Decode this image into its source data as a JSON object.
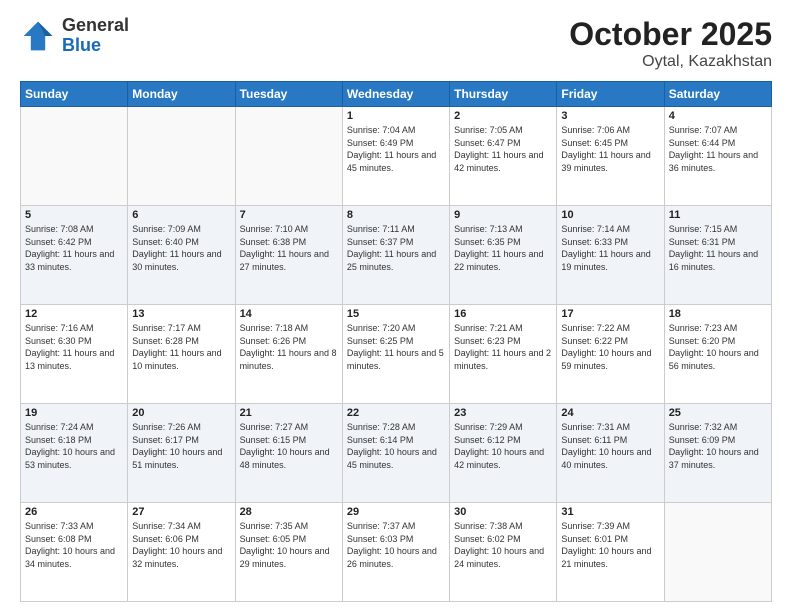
{
  "logo": {
    "general": "General",
    "blue": "Blue"
  },
  "title": "October 2025",
  "subtitle": "Oytal, Kazakhstan",
  "weekdays": [
    "Sunday",
    "Monday",
    "Tuesday",
    "Wednesday",
    "Thursday",
    "Friday",
    "Saturday"
  ],
  "weeks": [
    [
      {
        "day": "",
        "sunrise": "",
        "sunset": "",
        "daylight": ""
      },
      {
        "day": "",
        "sunrise": "",
        "sunset": "",
        "daylight": ""
      },
      {
        "day": "",
        "sunrise": "",
        "sunset": "",
        "daylight": ""
      },
      {
        "day": "1",
        "sunrise": "Sunrise: 7:04 AM",
        "sunset": "Sunset: 6:49 PM",
        "daylight": "Daylight: 11 hours and 45 minutes."
      },
      {
        "day": "2",
        "sunrise": "Sunrise: 7:05 AM",
        "sunset": "Sunset: 6:47 PM",
        "daylight": "Daylight: 11 hours and 42 minutes."
      },
      {
        "day": "3",
        "sunrise": "Sunrise: 7:06 AM",
        "sunset": "Sunset: 6:45 PM",
        "daylight": "Daylight: 11 hours and 39 minutes."
      },
      {
        "day": "4",
        "sunrise": "Sunrise: 7:07 AM",
        "sunset": "Sunset: 6:44 PM",
        "daylight": "Daylight: 11 hours and 36 minutes."
      }
    ],
    [
      {
        "day": "5",
        "sunrise": "Sunrise: 7:08 AM",
        "sunset": "Sunset: 6:42 PM",
        "daylight": "Daylight: 11 hours and 33 minutes."
      },
      {
        "day": "6",
        "sunrise": "Sunrise: 7:09 AM",
        "sunset": "Sunset: 6:40 PM",
        "daylight": "Daylight: 11 hours and 30 minutes."
      },
      {
        "day": "7",
        "sunrise": "Sunrise: 7:10 AM",
        "sunset": "Sunset: 6:38 PM",
        "daylight": "Daylight: 11 hours and 27 minutes."
      },
      {
        "day": "8",
        "sunrise": "Sunrise: 7:11 AM",
        "sunset": "Sunset: 6:37 PM",
        "daylight": "Daylight: 11 hours and 25 minutes."
      },
      {
        "day": "9",
        "sunrise": "Sunrise: 7:13 AM",
        "sunset": "Sunset: 6:35 PM",
        "daylight": "Daylight: 11 hours and 22 minutes."
      },
      {
        "day": "10",
        "sunrise": "Sunrise: 7:14 AM",
        "sunset": "Sunset: 6:33 PM",
        "daylight": "Daylight: 11 hours and 19 minutes."
      },
      {
        "day": "11",
        "sunrise": "Sunrise: 7:15 AM",
        "sunset": "Sunset: 6:31 PM",
        "daylight": "Daylight: 11 hours and 16 minutes."
      }
    ],
    [
      {
        "day": "12",
        "sunrise": "Sunrise: 7:16 AM",
        "sunset": "Sunset: 6:30 PM",
        "daylight": "Daylight: 11 hours and 13 minutes."
      },
      {
        "day": "13",
        "sunrise": "Sunrise: 7:17 AM",
        "sunset": "Sunset: 6:28 PM",
        "daylight": "Daylight: 11 hours and 10 minutes."
      },
      {
        "day": "14",
        "sunrise": "Sunrise: 7:18 AM",
        "sunset": "Sunset: 6:26 PM",
        "daylight": "Daylight: 11 hours and 8 minutes."
      },
      {
        "day": "15",
        "sunrise": "Sunrise: 7:20 AM",
        "sunset": "Sunset: 6:25 PM",
        "daylight": "Daylight: 11 hours and 5 minutes."
      },
      {
        "day": "16",
        "sunrise": "Sunrise: 7:21 AM",
        "sunset": "Sunset: 6:23 PM",
        "daylight": "Daylight: 11 hours and 2 minutes."
      },
      {
        "day": "17",
        "sunrise": "Sunrise: 7:22 AM",
        "sunset": "Sunset: 6:22 PM",
        "daylight": "Daylight: 10 hours and 59 minutes."
      },
      {
        "day": "18",
        "sunrise": "Sunrise: 7:23 AM",
        "sunset": "Sunset: 6:20 PM",
        "daylight": "Daylight: 10 hours and 56 minutes."
      }
    ],
    [
      {
        "day": "19",
        "sunrise": "Sunrise: 7:24 AM",
        "sunset": "Sunset: 6:18 PM",
        "daylight": "Daylight: 10 hours and 53 minutes."
      },
      {
        "day": "20",
        "sunrise": "Sunrise: 7:26 AM",
        "sunset": "Sunset: 6:17 PM",
        "daylight": "Daylight: 10 hours and 51 minutes."
      },
      {
        "day": "21",
        "sunrise": "Sunrise: 7:27 AM",
        "sunset": "Sunset: 6:15 PM",
        "daylight": "Daylight: 10 hours and 48 minutes."
      },
      {
        "day": "22",
        "sunrise": "Sunrise: 7:28 AM",
        "sunset": "Sunset: 6:14 PM",
        "daylight": "Daylight: 10 hours and 45 minutes."
      },
      {
        "day": "23",
        "sunrise": "Sunrise: 7:29 AM",
        "sunset": "Sunset: 6:12 PM",
        "daylight": "Daylight: 10 hours and 42 minutes."
      },
      {
        "day": "24",
        "sunrise": "Sunrise: 7:31 AM",
        "sunset": "Sunset: 6:11 PM",
        "daylight": "Daylight: 10 hours and 40 minutes."
      },
      {
        "day": "25",
        "sunrise": "Sunrise: 7:32 AM",
        "sunset": "Sunset: 6:09 PM",
        "daylight": "Daylight: 10 hours and 37 minutes."
      }
    ],
    [
      {
        "day": "26",
        "sunrise": "Sunrise: 7:33 AM",
        "sunset": "Sunset: 6:08 PM",
        "daylight": "Daylight: 10 hours and 34 minutes."
      },
      {
        "day": "27",
        "sunrise": "Sunrise: 7:34 AM",
        "sunset": "Sunset: 6:06 PM",
        "daylight": "Daylight: 10 hours and 32 minutes."
      },
      {
        "day": "28",
        "sunrise": "Sunrise: 7:35 AM",
        "sunset": "Sunset: 6:05 PM",
        "daylight": "Daylight: 10 hours and 29 minutes."
      },
      {
        "day": "29",
        "sunrise": "Sunrise: 7:37 AM",
        "sunset": "Sunset: 6:03 PM",
        "daylight": "Daylight: 10 hours and 26 minutes."
      },
      {
        "day": "30",
        "sunrise": "Sunrise: 7:38 AM",
        "sunset": "Sunset: 6:02 PM",
        "daylight": "Daylight: 10 hours and 24 minutes."
      },
      {
        "day": "31",
        "sunrise": "Sunrise: 7:39 AM",
        "sunset": "Sunset: 6:01 PM",
        "daylight": "Daylight: 10 hours and 21 minutes."
      },
      {
        "day": "",
        "sunrise": "",
        "sunset": "",
        "daylight": ""
      }
    ]
  ]
}
